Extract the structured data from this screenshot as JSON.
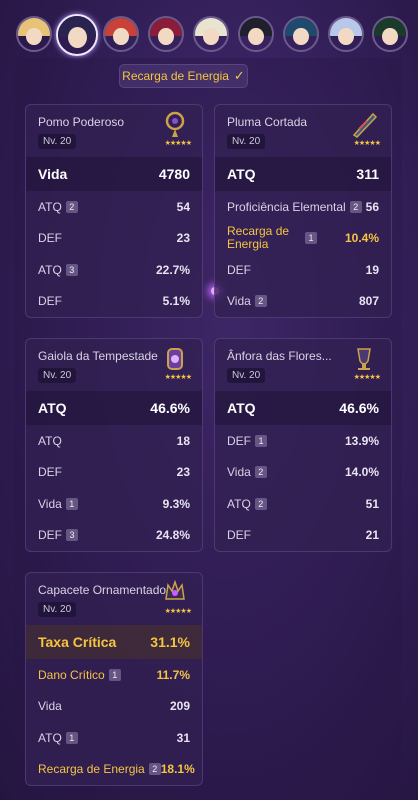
{
  "filter": {
    "label": "Recarga de Energia",
    "icon": "check-icon"
  },
  "avatars": [
    {
      "name": "character-1",
      "hair": "#e8c277"
    },
    {
      "name": "character-2",
      "hair": "#2a2350",
      "selected": true
    },
    {
      "name": "character-3",
      "hair": "#c8423a"
    },
    {
      "name": "character-4",
      "hair": "#8a1d3a"
    },
    {
      "name": "character-5",
      "hair": "#e8e4d0"
    },
    {
      "name": "character-6",
      "hair": "#1f1f2e"
    },
    {
      "name": "character-7",
      "hair": "#1f4a6e"
    },
    {
      "name": "character-8",
      "hair": "#b8c8e8"
    },
    {
      "name": "character-9",
      "hair": "#1a3a2a"
    }
  ],
  "cards": [
    {
      "title": "Pomo Poderoso",
      "level": "Nv. 20",
      "stars": "★★★★★",
      "main": {
        "name": "Vida",
        "value": "4780"
      },
      "subs": [
        {
          "name": "ATQ",
          "badge": "2",
          "value": "54"
        },
        {
          "name": "DEF",
          "badge": "",
          "value": "23"
        },
        {
          "name": "ATQ",
          "badge": "3",
          "value": "22.7%"
        },
        {
          "name": "DEF",
          "badge": "",
          "value": "5.1%"
        }
      ]
    },
    {
      "title": "Pluma Cortada",
      "level": "Nv. 20",
      "stars": "★★★★★",
      "main": {
        "name": "ATQ",
        "value": "311"
      },
      "subs": [
        {
          "name": "Proficiência Elemental",
          "badge": "2",
          "value": "56"
        },
        {
          "name": "Recarga de Energia",
          "badge": "1",
          "value": "10.4%",
          "gold": true
        },
        {
          "name": "DEF",
          "badge": "",
          "value": "19"
        },
        {
          "name": "Vida",
          "badge": "2",
          "value": "807"
        }
      ]
    },
    {
      "title": "Gaiola da Tempestade",
      "level": "Nv. 20",
      "stars": "★★★★★",
      "main": {
        "name": "ATQ",
        "value": "46.6%"
      },
      "subs": [
        {
          "name": "ATQ",
          "badge": "",
          "value": "18"
        },
        {
          "name": "DEF",
          "badge": "",
          "value": "23"
        },
        {
          "name": "Vida",
          "badge": "1",
          "value": "9.3%"
        },
        {
          "name": "DEF",
          "badge": "3",
          "value": "24.8%"
        }
      ]
    },
    {
      "title": "Ânfora das Flores...",
      "level": "Nv. 20",
      "stars": "★★★★★",
      "main": {
        "name": "ATQ",
        "value": "46.6%"
      },
      "subs": [
        {
          "name": "DEF",
          "badge": "1",
          "value": "13.9%"
        },
        {
          "name": "Vida",
          "badge": "2",
          "value": "14.0%"
        },
        {
          "name": "ATQ",
          "badge": "2",
          "value": "51"
        },
        {
          "name": "DEF",
          "badge": "",
          "value": "21"
        }
      ]
    },
    {
      "title": "Capacete Ornamentado",
      "level": "Nv. 20",
      "stars": "★★★★★",
      "main": {
        "name": "Taxa Crítica",
        "value": "31.1%",
        "crit": true
      },
      "subs": [
        {
          "name": "Dano Crítico",
          "badge": "1",
          "value": "11.7%",
          "gold": true
        },
        {
          "name": "Vida",
          "badge": "",
          "value": "209"
        },
        {
          "name": "ATQ",
          "badge": "1",
          "value": "31"
        },
        {
          "name": "Recarga de Energia",
          "badge": "2",
          "value": "18.1%",
          "gold": true
        }
      ]
    }
  ]
}
